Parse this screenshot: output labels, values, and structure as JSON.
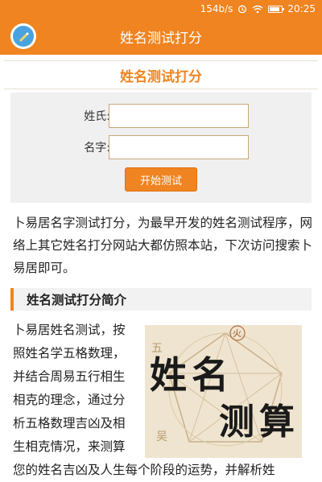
{
  "status_bar": {
    "speed": "154b/s",
    "time": "20:25"
  },
  "app_bar": {
    "title": "姓名测试打分"
  },
  "page": {
    "heading": "姓名测试打分"
  },
  "form": {
    "surname_label": "姓氏:",
    "surname_value": "",
    "name_label": "名字:",
    "name_value": "",
    "submit_label": "开始测试"
  },
  "intro_text": "卜易居名字测试打分，为最早开发的姓名测试程序，网络上其它姓名打分网站大都仿照本站，下次访问搜索卜易居即可。",
  "section": {
    "title": "姓名测试打分简介",
    "body_lines": [
      "卜易居姓名测试，按",
      "照姓名学五格数理，",
      "并结合周易五行相生",
      "相克的理念，通过分",
      "析五格数理吉凶及相",
      "生相克情况，来测算"
    ],
    "body_full_line": "您的姓名吉凶及人生每个阶段的运势，并解析姓"
  },
  "image": {
    "text_line1": "姓名",
    "text_line2": "测算",
    "bg_glyphs": [
      "火",
      "五",
      "吴"
    ]
  },
  "colors": {
    "accent": "#f08420",
    "heading_text": "#f08420"
  }
}
